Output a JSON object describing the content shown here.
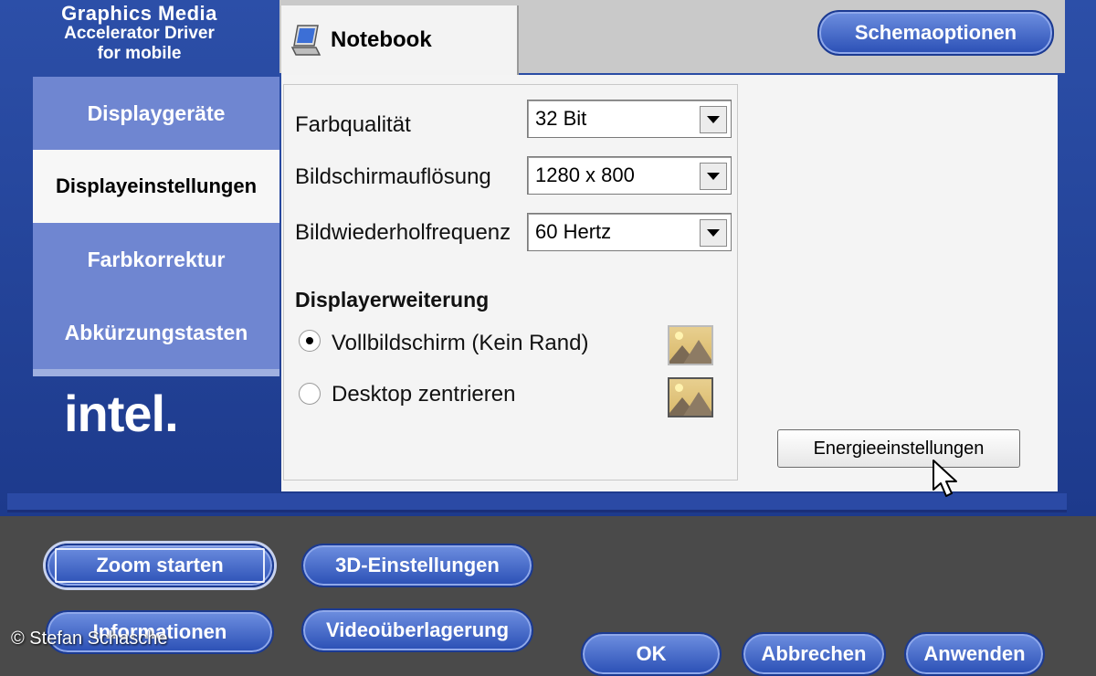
{
  "header": {
    "logo_line1": "Graphics Media",
    "logo_line2": "Accelerator Driver",
    "logo_line3": "for mobile",
    "schema_button": "Schemaoptionen"
  },
  "sidebar": {
    "items": [
      {
        "label": "Displaygeräte",
        "state": "inactive"
      },
      {
        "label": "Displayeinstellungen",
        "state": "active"
      },
      {
        "label": "Farbkorrektur",
        "state": "inactive"
      },
      {
        "label": "Abkürzungstasten",
        "state": "inactive"
      }
    ],
    "brand": "intel."
  },
  "tab": {
    "label": "Notebook",
    "icon": "notebook-icon"
  },
  "settings": {
    "color_quality_label": "Farbqualität",
    "color_quality_value": "32 Bit",
    "resolution_label": "Bildschirmauflösung",
    "resolution_value": "1280 x 800",
    "refresh_label": "Bildwiederholfrequenz",
    "refresh_value": "60 Hertz",
    "extension_heading": "Displayerweiterung",
    "option_fullscreen": "Vollbildschirm (Kein Rand)",
    "option_center": "Desktop zentrieren",
    "selected_option": "fullscreen"
  },
  "energy_button": "Energieeinstellungen",
  "bottom_buttons": {
    "zoom": "Zoom starten",
    "three_d": "3D-Einstellungen",
    "info": "Informationen",
    "video": "Videoüberlagerung",
    "ok": "OK",
    "cancel": "Abbrechen",
    "apply": "Anwenden"
  },
  "watermark": "© Stefan Schasche",
  "colors": {
    "frame_blue": "#2c4fa8",
    "nav_light": "#6f86d1",
    "nav_active": "#f7f7f7",
    "bottom_bg": "#4a4a4a"
  }
}
